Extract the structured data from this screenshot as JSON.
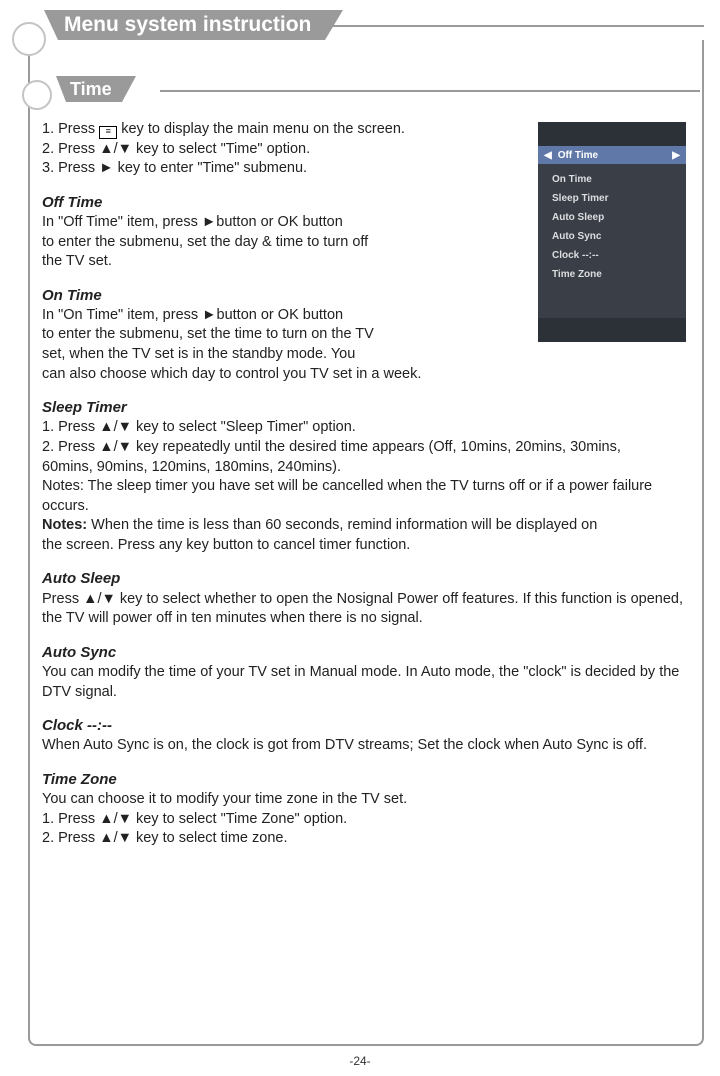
{
  "page": {
    "title": "Menu system instruction",
    "subtitle": "Time",
    "number": "-24-"
  },
  "intro": {
    "line1_pre": "1. Press ",
    "line1_post": " key to display the main menu on the screen.",
    "menu_icon_glyph": "≡",
    "line2": "2. Press ▲/▼ key to select \"Time\" option.",
    "line3": "3. Press ► key to enter \"Time\" submenu."
  },
  "osd": {
    "selected": "Off Time",
    "items": [
      "On Time",
      "Sleep Timer",
      "Auto Sleep",
      "Auto Sync",
      "Clock --:--",
      "Time Zone"
    ]
  },
  "sections": {
    "offtime": {
      "title": " Off Time",
      "body": "In \"Off Time\" item, press ►button or OK  button\nto enter the submenu, set the day & time to turn off\nthe TV set."
    },
    "ontime": {
      "title": "On Time",
      "body": "In \"On Time\" item, press ►button or OK button\nto enter the submenu, set the time to turn on the TV\nset, when the TV set is in the standby mode. You\ncan also choose which day to control you TV set in a week."
    },
    "sleeptimer": {
      "title": "Sleep Timer",
      "line1": "1. Press ▲/▼ key to select \"Sleep Timer\" option.",
      "line2": "2. Press ▲/▼ key repeatedly until the desired time appears (Off, 10mins, 20mins, 30mins,",
      "line2b": "    60mins, 90mins, 120mins, 180mins, 240mins).",
      "notes1": "Notes: The sleep timer you have set will be cancelled when the TV turns off or if a power failure occurs.",
      "notes2_label": "Notes:",
      "notes2_body": " When the time is less than 60 seconds, remind information will be displayed on\n             the screen. Press any key button to cancel timer function."
    },
    "autosleep": {
      "title": "Auto Sleep",
      "body": "Press ▲/▼ key to select whether to open the Nosignal Power off features. If this function is opened, the TV will power off  in ten minutes when there is no signal."
    },
    "autosync": {
      "title": "Auto Sync",
      "body": "You can modify the time of your TV set in Manual mode. In Auto mode, the \"clock\" is decided by the DTV signal."
    },
    "clock": {
      "title": "Clock --:--",
      "body": "When Auto Sync is on, the clock is got from DTV streams; Set the clock when Auto Sync is off."
    },
    "timezone": {
      "title": "Time Zone",
      "body": "You can choose it to modify your time zone in the TV set.",
      "line1": "1. Press ▲/▼ key to select \"Time Zone\" option.",
      "line2": "2. Press ▲/▼ key to select time zone."
    }
  }
}
